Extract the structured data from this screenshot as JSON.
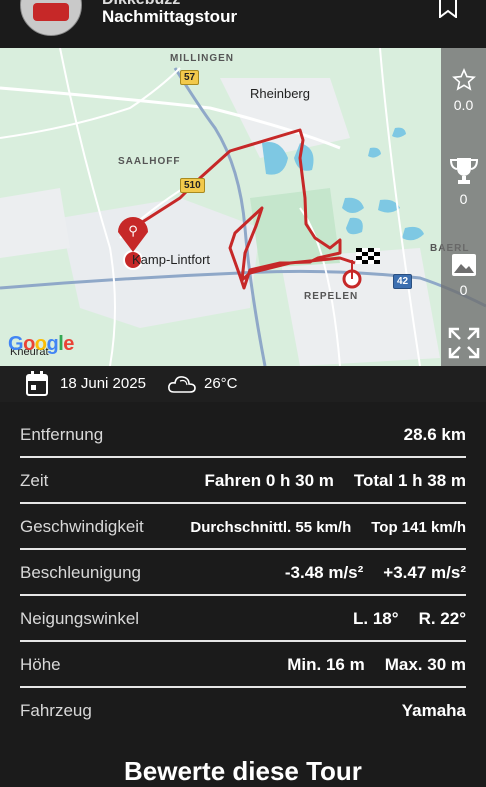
{
  "header": {
    "username": "Dikkebuzz",
    "tour_name": "Nachmittagstour"
  },
  "map": {
    "labels": {
      "millingen": "MILLINGEN",
      "rheinberg": "Rheinberg",
      "saalhoff": "SAALHOFF",
      "kamp_lintfort": "Kamp-Lintfort",
      "repelen": "REPELEN",
      "baerl": "BAERL",
      "kneurat": "Kneurat",
      "google": "Google"
    },
    "road_shields": {
      "r57": "57",
      "r510": "510",
      "r42": "42"
    },
    "sidebar": {
      "rating_value": "0.0",
      "trophy_count": "0",
      "photo_count": "0"
    }
  },
  "meta": {
    "date": "18 Juni 2025",
    "temperature": "26°C"
  },
  "stats": {
    "distance": {
      "label": "Entfernung",
      "value": "28.6 km"
    },
    "time": {
      "label": "Zeit",
      "drive": "Fahren 0 h 30 m",
      "total": "Total 1 h 38 m"
    },
    "speed": {
      "label": "Geschwindigkeit",
      "avg": "Durchschnittl. 55 km/h",
      "top": "Top 141 km/h"
    },
    "acceleration": {
      "label": "Beschleunigung",
      "min": "-3.48 m/s²",
      "max": "+3.47 m/s²"
    },
    "lean": {
      "label": "Neigungswinkel",
      "left": "L. 18°",
      "right": "R. 22°"
    },
    "altitude": {
      "label": "Höhe",
      "min": "Min. 16 m",
      "max": "Max. 30 m"
    },
    "vehicle": {
      "label": "Fahrzeug",
      "value": "Yamaha"
    }
  },
  "footer": {
    "title": "Bewerte diese Tour"
  },
  "colors": {
    "route": "#c62828",
    "background": "#1b1b1b",
    "map_green": "#d9eedd",
    "water": "#7ec8e3"
  }
}
